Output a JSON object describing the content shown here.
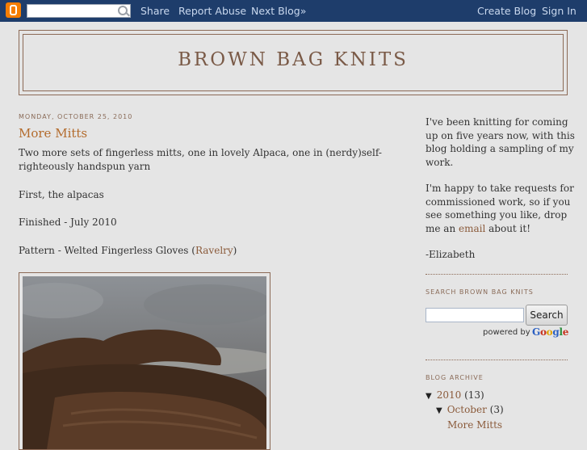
{
  "navbar": {
    "search_placeholder": "",
    "links": [
      "Share",
      "Report Abuse",
      "Next Blog»",
      "Create Blog",
      "Sign In"
    ]
  },
  "header": {
    "title": "BROWN BAG KNITS"
  },
  "post": {
    "date": "MONDAY, OCTOBER 25, 2010",
    "title": "More Mitts",
    "intro": "Two more sets of fingerless mitts, one in lovely Alpaca, one in (nerdy)self-righteously handspun yarn",
    "line1": "First, the alpacas",
    "line2": "Finished - July 2010",
    "pattern_prefix": "Pattern - Welted Fingerless Gloves (",
    "pattern_link": "Ravelry",
    "pattern_suffix": ")"
  },
  "sidebar": {
    "about1": "I've been knitting for coming up on five years now, with this blog holding a sampling of my work.",
    "about2_prefix": "I'm happy to take requests for commissioned work, so if you see something you like, drop me an ",
    "about2_link": "email",
    "about2_suffix": " about it!",
    "signature": "-Elizabeth",
    "search_heading": "SEARCH BROWN BAG KNITS",
    "search_button": "Search",
    "powered_by": "powered by",
    "google": [
      "G",
      "o",
      "o",
      "g",
      "l",
      "e"
    ],
    "archive_heading": "BLOG ARCHIVE",
    "archive": [
      {
        "toggle": "▼",
        "label": "2010",
        "count": "(13)"
      },
      {
        "toggle": "▼",
        "label": "October",
        "count": "(3)"
      },
      {
        "label": "More Mitts"
      }
    ]
  },
  "colors": {
    "navbar": "#1e3d6b",
    "link": "#8a5a3a",
    "title": "#b36b2c",
    "border": "#8c6a56"
  }
}
